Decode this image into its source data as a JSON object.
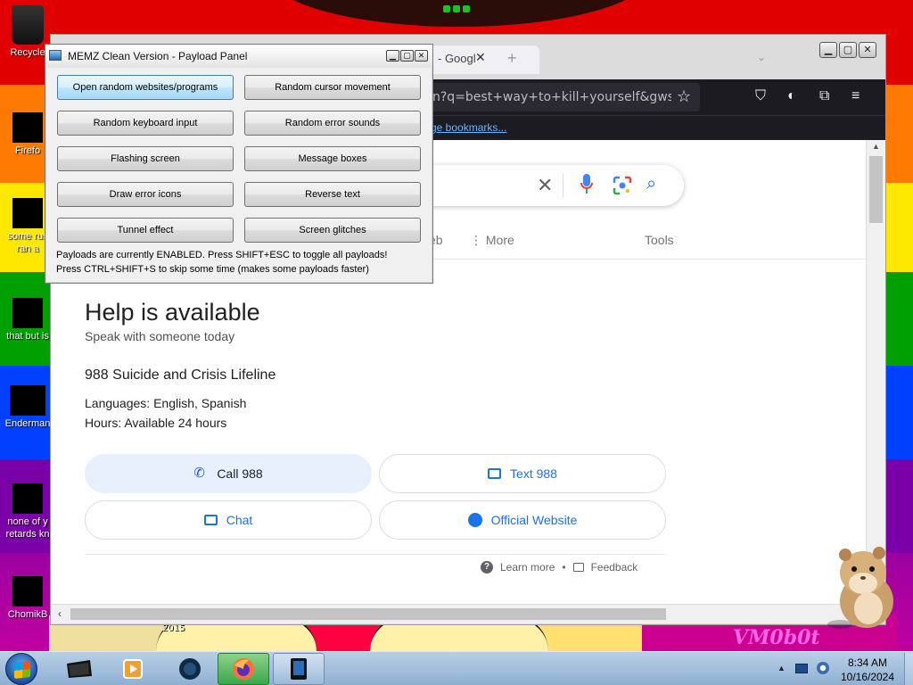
{
  "desktop": {
    "icons": [
      {
        "label": "Recycle"
      },
      {
        "label": "Firefo"
      },
      {
        "label": "some rus"
      },
      {
        "label": "ran a"
      },
      {
        "label": "that but is"
      },
      {
        "label": "Enderman"
      },
      {
        "label": "none of y"
      },
      {
        "label": "retards kn"
      },
      {
        "label": "ChomikB"
      }
    ],
    "bg_text_year": "2015",
    "bg_text_logo": "VM0b0t"
  },
  "firefox": {
    "tab_title": "- Googl",
    "tab_close": "✕",
    "new_tab": "+",
    "url": "n?q=best+way+to+kill+yourself&gws_rd=",
    "bookmarks_link": "ge bookmarks..."
  },
  "google": {
    "tabs": [
      "eb",
      "⋮ More",
      "Tools"
    ],
    "help_title": "Help is available",
    "help_subtitle": "Speak with someone today",
    "org_name": "988 Suicide and Crisis Lifeline",
    "languages": "Languages: English, Spanish",
    "hours": "Hours: Available 24 hours",
    "call_label": "Call 988",
    "text_label": "Text 988",
    "chat_label": "Chat",
    "website_label": "Official Website",
    "learn_more": "Learn more",
    "dot": "•",
    "feedback": "Feedback",
    "accent": "#1a73e8"
  },
  "memz": {
    "title": "MEMZ Clean Version - Payload Panel",
    "buttons": [
      "Open random websites/programs",
      "Random cursor movement",
      "Random keyboard input",
      "Random error sounds",
      "Flashing screen",
      "Message boxes",
      "Draw error icons",
      "Reverse text",
      "Tunnel effect",
      "Screen glitches"
    ],
    "status_line1": "Payloads are currently ENABLED. Press SHIFT+ESC to toggle all payloads!",
    "status_line2": "Press CTRL+SHIFT+S to skip some time (makes some payloads faster)"
  },
  "taskbar": {
    "time": "8:34 AM",
    "date": "10/16/2024",
    "show_hidden": "▲"
  }
}
